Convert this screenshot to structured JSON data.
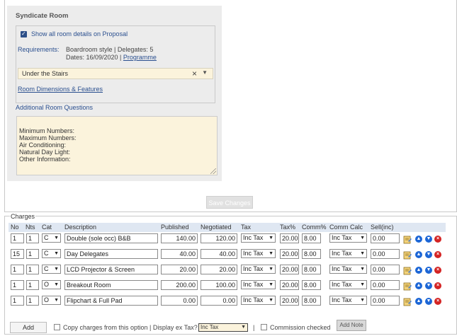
{
  "room": {
    "title": "Syndicate Room",
    "show_details_label": "Show all room details on Proposal",
    "requirements_label": "Requirements:",
    "requirements_line1": "Boardroom style | Delegates: 5",
    "requirements_dates": "Dates: 16/09/2020 | ",
    "requirements_programme": "Programme",
    "selected_room": "Under the Stairs",
    "dimensions_link": "Room Dimensions & Features",
    "additional_title": "Additional Room Questions",
    "questions_text": "Minimum Numbers:\nMaximum Numbers:\nAir Conditioning:\nNatural Day Light:\nOther Information:",
    "save_button": "Save Changes"
  },
  "charges": {
    "legend": "Charges",
    "headers": {
      "no": "No",
      "nts": "Nts",
      "cat": "Cat",
      "description": "Description",
      "published": "Published",
      "negotiated": "Negotiated",
      "tax": "Tax",
      "taxpct": "Tax%",
      "commpct": "Comm%",
      "commcalc": "Comm Calc",
      "sell": "Sell(inc)"
    },
    "rows": [
      {
        "no": "1",
        "nts": "1",
        "cat": "C",
        "description": "Double (sole occ) B&B",
        "published": "140.00",
        "negotiated": "120.00",
        "tax": "Inc Tax",
        "taxpct": "20.00",
        "commpct": "8.00",
        "commcalc": "Inc Tax",
        "sell": "0.00"
      },
      {
        "no": "15",
        "nts": "1",
        "cat": "C",
        "description": "Day Delegates",
        "published": "40.00",
        "negotiated": "40.00",
        "tax": "Inc Tax",
        "taxpct": "20.00",
        "commpct": "8.00",
        "commcalc": "Inc Tax",
        "sell": "0.00"
      },
      {
        "no": "1",
        "nts": "1",
        "cat": "C",
        "description": "LCD Projector & Screen",
        "published": "20.00",
        "negotiated": "20.00",
        "tax": "Inc Tax",
        "taxpct": "20.00",
        "commpct": "8.00",
        "commcalc": "Inc Tax",
        "sell": "0.00"
      },
      {
        "no": "1",
        "nts": "1",
        "cat": "O",
        "description": "Breakout Room",
        "published": "200.00",
        "negotiated": "100.00",
        "tax": "Inc Tax",
        "taxpct": "20.00",
        "commpct": "8.00",
        "commcalc": "Inc Tax",
        "sell": "0.00"
      },
      {
        "no": "1",
        "nts": "1",
        "cat": "O",
        "description": "Flipchart & Full Pad",
        "published": "0.00",
        "negotiated": "0.00",
        "tax": "Inc Tax",
        "taxpct": "20.00",
        "commpct": "8.00",
        "commcalc": "Inc Tax",
        "sell": "0.00"
      }
    ]
  },
  "footer": {
    "add_button": "Add",
    "copy_label": "Copy charges from this option | Display ex Tax?",
    "display_select": "Inc Tax",
    "separator": "|",
    "commission_label": "Commission checked",
    "add_note_button": "Add Note"
  },
  "colors": {
    "link": "#2a4f8f",
    "panel_bg": "#ececec",
    "input_bg": "#fbf3dc",
    "header_bg": "#dfe7f2"
  }
}
